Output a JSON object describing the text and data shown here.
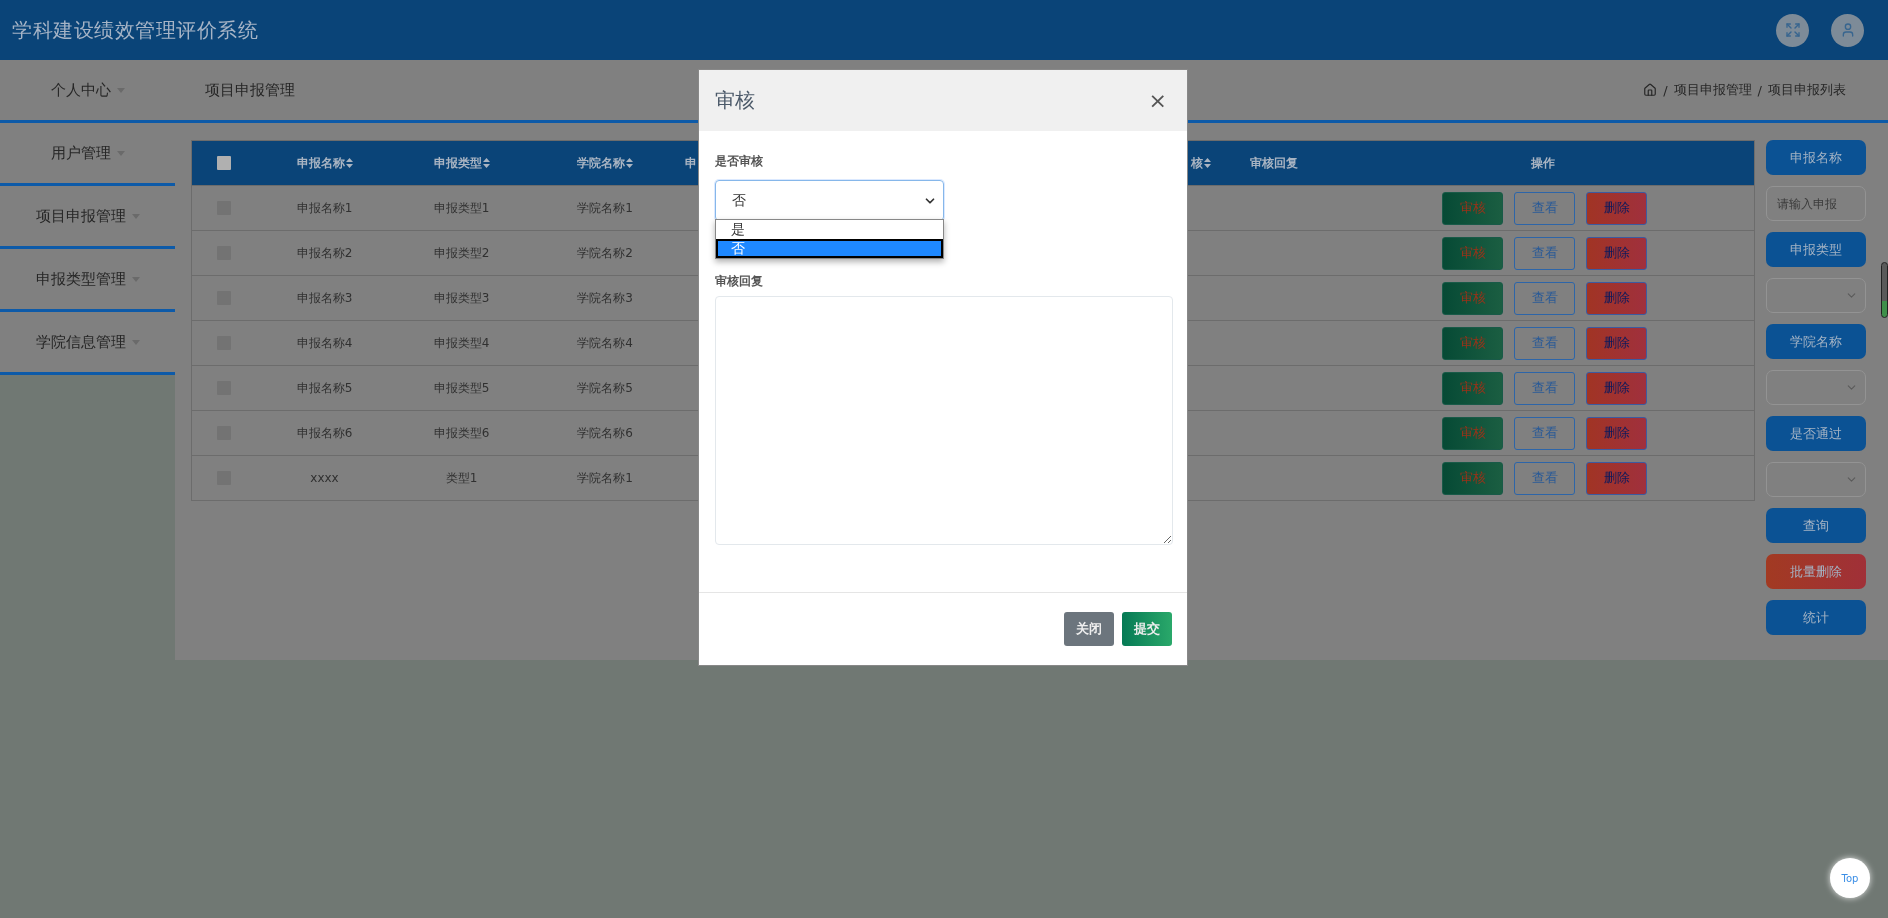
{
  "header": {
    "title": "学科建设绩效管理评价系统"
  },
  "nav": {
    "menu": "个人中心",
    "page_title": "项目申报管理",
    "breadcrumb": [
      {
        "sep": "/",
        "label": "项目申报管理"
      },
      {
        "sep": "/",
        "label": "项目申报列表"
      }
    ]
  },
  "sidebar": [
    {
      "label": "用户管理"
    },
    {
      "label": "项目申报管理"
    },
    {
      "label": "申报类型管理"
    },
    {
      "label": "学院信息管理"
    }
  ],
  "table": {
    "select_all_checked": false,
    "columns": [
      {
        "label": "申报名称",
        "sortable": true
      },
      {
        "label": "申报类型",
        "sortable": true
      },
      {
        "label": "学院名称",
        "sortable": true
      },
      {
        "label": "申",
        "sortable": false
      },
      {
        "label": "核",
        "sortable": true
      },
      {
        "label": "审核回复",
        "sortable": false
      },
      {
        "label": "操作",
        "sortable": false
      }
    ],
    "rows": [
      {
        "checked": false,
        "cells": [
          "申报名称1",
          "申报类型1",
          "学院名称1"
        ],
        "actions": [
          {
            "label": "审核",
            "kind": "review"
          },
          {
            "label": "查看",
            "kind": "view"
          },
          {
            "label": "删除",
            "kind": "delete"
          }
        ]
      },
      {
        "checked": false,
        "cells": [
          "申报名称2",
          "申报类型2",
          "学院名称2"
        ],
        "actions": [
          {
            "label": "审核",
            "kind": "review"
          },
          {
            "label": "查看",
            "kind": "view"
          },
          {
            "label": "删除",
            "kind": "delete"
          }
        ]
      },
      {
        "checked": false,
        "cells": [
          "申报名称3",
          "申报类型3",
          "学院名称3"
        ],
        "actions": [
          {
            "label": "审核",
            "kind": "review"
          },
          {
            "label": "查看",
            "kind": "view"
          },
          {
            "label": "删除",
            "kind": "delete"
          }
        ]
      },
      {
        "checked": false,
        "cells": [
          "申报名称4",
          "申报类型4",
          "学院名称4"
        ],
        "actions": [
          {
            "label": "审核",
            "kind": "review"
          },
          {
            "label": "查看",
            "kind": "view"
          },
          {
            "label": "删除",
            "kind": "delete"
          }
        ]
      },
      {
        "checked": false,
        "cells": [
          "申报名称5",
          "申报类型5",
          "学院名称5"
        ],
        "actions": [
          {
            "label": "审核",
            "kind": "review"
          },
          {
            "label": "查看",
            "kind": "view"
          },
          {
            "label": "删除",
            "kind": "delete"
          }
        ]
      },
      {
        "checked": false,
        "cells": [
          "申报名称6",
          "申报类型6",
          "学院名称6"
        ],
        "actions": [
          {
            "label": "审核",
            "kind": "review"
          },
          {
            "label": "查看",
            "kind": "view"
          },
          {
            "label": "删除",
            "kind": "delete"
          }
        ]
      },
      {
        "checked": false,
        "cells": [
          "xxxx",
          "类型1",
          "学院名称1"
        ],
        "actions": [
          {
            "label": "审核",
            "kind": "review"
          },
          {
            "label": "查看",
            "kind": "view"
          },
          {
            "label": "删除",
            "kind": "delete"
          }
        ]
      }
    ]
  },
  "filters": [
    {
      "kind": "button",
      "label": "申报名称"
    },
    {
      "kind": "input",
      "placeholder": "请输入申报"
    },
    {
      "kind": "button",
      "label": "申报类型"
    },
    {
      "kind": "select"
    },
    {
      "kind": "button",
      "label": "学院名称"
    },
    {
      "kind": "select"
    },
    {
      "kind": "button",
      "label": "是否通过"
    },
    {
      "kind": "select"
    },
    {
      "kind": "button",
      "label": "查询"
    },
    {
      "kind": "danger",
      "label": "批量删除"
    },
    {
      "kind": "button",
      "label": "统计"
    }
  ],
  "modal": {
    "title": "审核",
    "close": "×",
    "fields": [
      {
        "kind": "select",
        "label": "是否审核",
        "value": "否",
        "expanded": true,
        "options": [
          {
            "label": "是",
            "selected": false
          },
          {
            "label": "否",
            "selected": true
          }
        ]
      },
      {
        "kind": "textarea",
        "label": "审核回复"
      }
    ],
    "buttons": [
      {
        "label": "关闭",
        "kind": "secondary"
      },
      {
        "label": "提交",
        "kind": "primary"
      }
    ]
  },
  "back_to_top": "Top"
}
